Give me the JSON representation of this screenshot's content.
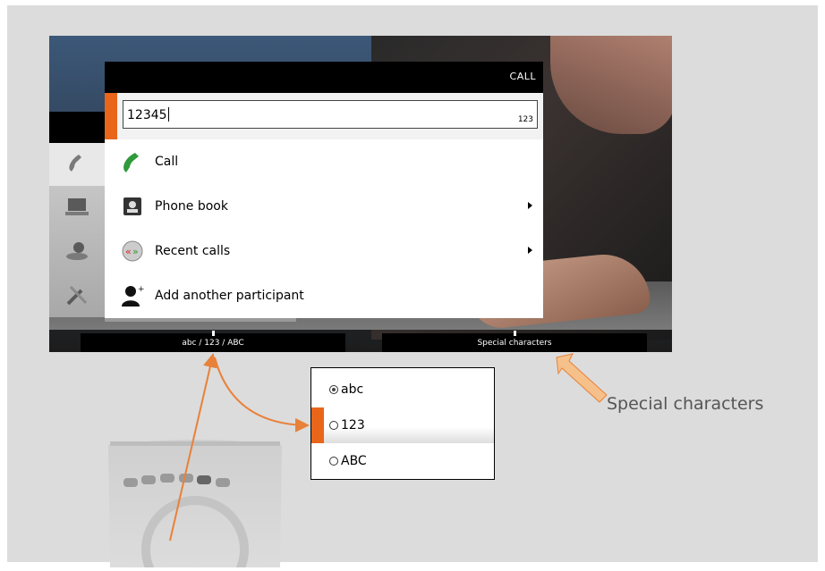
{
  "menu": {
    "title": "CALL",
    "input": {
      "value": "12345",
      "mode": "123"
    },
    "items": [
      {
        "label": "Call",
        "icon": "phone-handset-icon",
        "has_submenu": false
      },
      {
        "label": "Phone book",
        "icon": "phone-book-icon",
        "has_submenu": true
      },
      {
        "label": "Recent calls",
        "icon": "recent-calls-icon",
        "has_submenu": true
      },
      {
        "label": "Add another participant",
        "icon": "add-participant-icon",
        "has_submenu": false
      }
    ]
  },
  "sidebar": {
    "items": [
      {
        "icon": "phone-icon",
        "active": true
      },
      {
        "icon": "laptop-icon",
        "active": false
      },
      {
        "icon": "camera-icon",
        "active": false
      },
      {
        "icon": "tools-icon",
        "active": false
      }
    ]
  },
  "softkeys": {
    "left": "abc / 123 / ABC",
    "right": "Special characters"
  },
  "popup": {
    "items": [
      {
        "label": "abc",
        "checked": true,
        "highlighted": false
      },
      {
        "label": "123",
        "checked": false,
        "highlighted": true
      },
      {
        "label": "ABC",
        "checked": false,
        "highlighted": false
      }
    ]
  },
  "callout": {
    "label": "Special characters"
  },
  "colors": {
    "accent": "#e8651a",
    "call_green": "#2e9a3a",
    "arrow": "#e8813a"
  }
}
